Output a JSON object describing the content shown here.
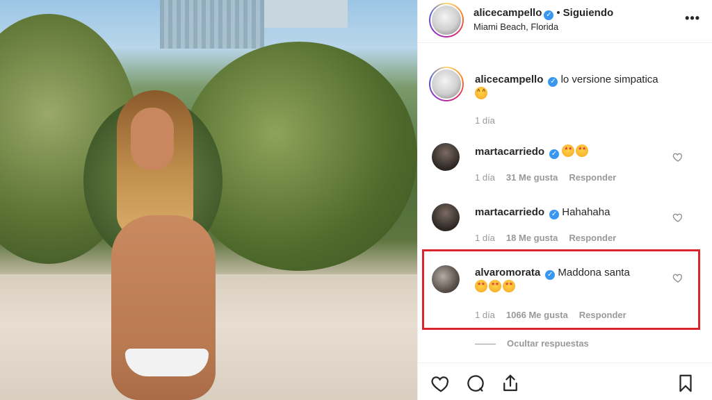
{
  "header": {
    "username": "alicecampello",
    "separator": "•",
    "following_label": "Siguiendo",
    "location": "Miami Beach, Florida",
    "more_icon": "more-options-icon"
  },
  "caption": {
    "username": "alicecampello",
    "text": "lo versione simpatica",
    "emoji": "laughing-emoji",
    "time": "1 día"
  },
  "comments": [
    {
      "username": "martacarriedo",
      "text": "",
      "emojis": [
        "star-struck-emoji",
        "star-struck-emoji"
      ],
      "time": "1 día",
      "likes": "31 Me gusta",
      "reply_label": "Responder"
    },
    {
      "username": "martacarriedo",
      "text": "Hahahaha",
      "time": "1 día",
      "likes": "18 Me gusta",
      "reply_label": "Responder"
    },
    {
      "username": "alvaromorata",
      "text": "Maddona santa",
      "emojis": [
        "star-struck-emoji",
        "star-struck-emoji",
        "star-struck-emoji"
      ],
      "time": "1 día",
      "likes": "1066 Me gusta",
      "reply_label": "Responder"
    }
  ],
  "hide_replies_label": "Ocultar respuestas",
  "colors": {
    "verified": "#3897f0",
    "highlight": "#d9262d",
    "meta_text": "#999999"
  },
  "actions": [
    "heart-icon",
    "comment-icon",
    "share-icon",
    "bookmark-icon"
  ]
}
